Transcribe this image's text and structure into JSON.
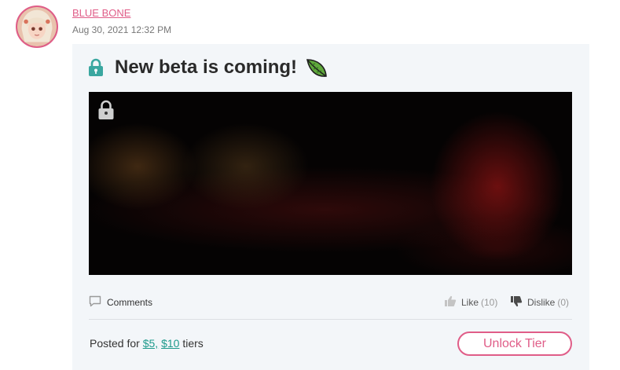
{
  "post": {
    "author": "BLUE BONE",
    "date": "Aug 30, 2021 12:32 PM",
    "title": "New beta is coming!",
    "title_emoji": "leaf-icon",
    "locked": true
  },
  "actions": {
    "comments_label": "Comments",
    "like_label": "Like",
    "like_count": "(10)",
    "dislike_label": "Dislike",
    "dislike_count": "(0)"
  },
  "footer": {
    "posted_prefix": "Posted for",
    "tier_1": "$5,",
    "tier_2": "$10",
    "posted_suffix": "tiers",
    "unlock_label": "Unlock Tier"
  },
  "colors": {
    "accent": "#e05d88",
    "lock": "#3aa7a0",
    "tier_link": "#1e9a8c",
    "card_bg": "#f3f6f9"
  }
}
